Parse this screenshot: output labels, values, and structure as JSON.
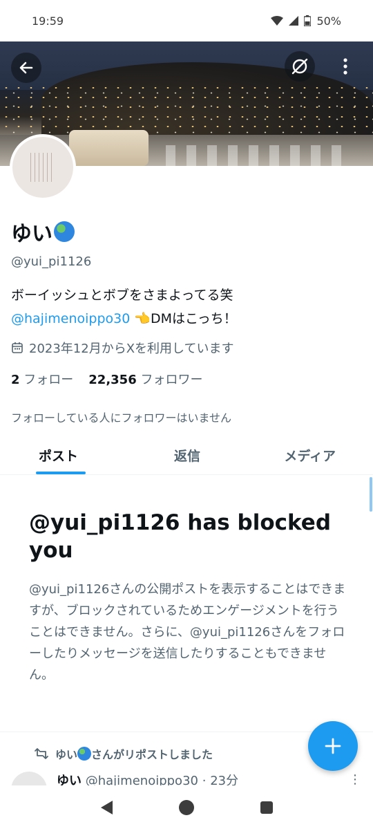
{
  "status_bar": {
    "time": "19:59",
    "battery": "50%"
  },
  "profile": {
    "display_name": "ゆい",
    "handle": "@yui_pi1126",
    "bio_line1": "ボーイッシュとボブをさまよってる笑",
    "bio_mention": "@hajimenoippo30",
    "bio_line2_rest": " 👈DMはこっち！",
    "joined": "2023年12月からXを利用しています",
    "following_count": "2",
    "following_label": "フォロー",
    "followers_count": "22,356",
    "followers_label": "フォロワー",
    "mutuals_text": "フォローしている人にフォロワーはいません"
  },
  "tabs": [
    {
      "label": "ポスト",
      "active": true
    },
    {
      "label": "返信",
      "active": false
    },
    {
      "label": "メディア",
      "active": false
    }
  ],
  "blocked": {
    "title": "@yui_pi1126 has blocked you",
    "description": "@yui_pi1126さんの公開ポストを表示することはできますが、ブロックされているためエンゲージメントを行うことはできません。さらに、@yui_pi1126さんをフォローしたりメッセージを送信したりすることもできません。"
  },
  "repost": {
    "label_name": "ゆい",
    "label_suffix": "さんがリポストしました",
    "author_name": "ゆい",
    "author_handle": "@hajimenoippo30",
    "separator": "·",
    "time": "23分",
    "more": "⋮"
  },
  "icons": {
    "back": "arrow-left-icon",
    "unmute": "eye-slash-icon",
    "more": "more-vertical-icon",
    "calendar": "calendar-icon",
    "repost": "repost-icon",
    "compose": "plus-icon"
  },
  "colors": {
    "accent": "#1d9bf0",
    "text": "#0f1419",
    "muted": "#536471"
  }
}
